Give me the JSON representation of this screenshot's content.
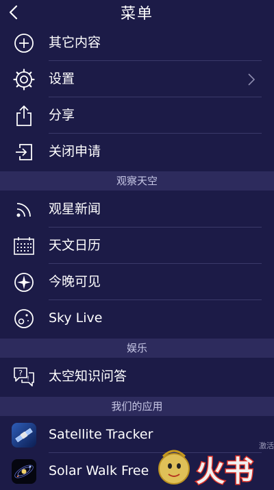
{
  "header": {
    "title": "菜单",
    "back_icon": "chevron-left-icon"
  },
  "menu_items": [
    {
      "label": "其它内容",
      "icon": "plus-circle-icon"
    },
    {
      "label": "设置",
      "icon": "gear-icon"
    },
    {
      "label": "分享",
      "icon": "share-icon"
    },
    {
      "label": "关闭申请",
      "icon": "exit-icon"
    }
  ],
  "sections": {
    "observe": "观察天空",
    "entertainment": "娱乐",
    "apps": "我们的应用"
  },
  "observe_items": [
    {
      "label": "观星新闻",
      "icon": "rss-icon"
    },
    {
      "label": "天文日历",
      "icon": "calendar-icon"
    },
    {
      "label": "今晚可见",
      "icon": "compass-star-icon"
    },
    {
      "label": "Sky Live",
      "icon": "planet-icon"
    }
  ],
  "entertainment_items": [
    {
      "label": "太空知识问答",
      "icon": "quiz-bubble-icon"
    }
  ],
  "app_items": [
    {
      "label": "Satellite Tracker",
      "icon": "satellite-app-icon"
    },
    {
      "label": "Solar Walk Free",
      "icon": "solar-walk-app-icon"
    }
  ],
  "watermark": {
    "text": "火书",
    "side_text": "激活 转到"
  },
  "colors": {
    "background": "#1c1b47",
    "section_bg": "#2d2b5d",
    "divider": "#3b3a6a",
    "text": "#ffffff"
  }
}
